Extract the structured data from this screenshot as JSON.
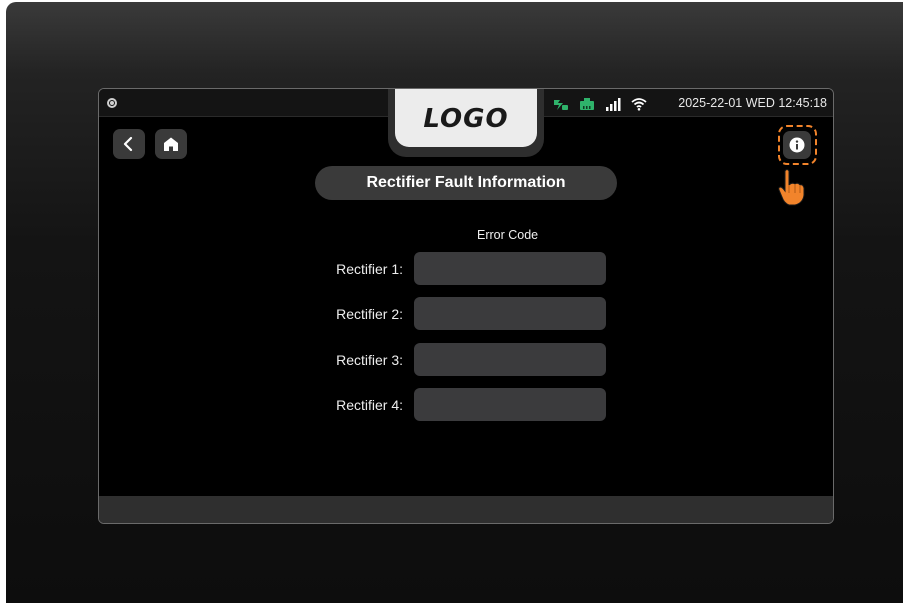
{
  "statusbar": {
    "logo_text": "LOGO",
    "datetime": "2025-22-01 WED 12:45:18",
    "icons": [
      "camera-icon",
      "charging-icon",
      "ethernet-icon",
      "signal-icon",
      "wifi-icon"
    ]
  },
  "nav": {
    "back_icon": "chevron-left-icon",
    "home_icon": "home-icon",
    "info_icon": "info-icon",
    "pointer_icon": "hand-pointer-icon"
  },
  "page": {
    "title": "Rectifier Fault Information",
    "column_header": "Error Code",
    "rows": [
      {
        "label": "Rectifier 1:",
        "value": ""
      },
      {
        "label": "Rectifier 2:",
        "value": ""
      },
      {
        "label": "Rectifier 3:",
        "value": ""
      },
      {
        "label": "Rectifier 4:",
        "value": ""
      }
    ]
  },
  "colors": {
    "accent_highlight": "#f2842b",
    "status_green": "#2fb36b",
    "panel": "#3a3a3a",
    "background": "#000000"
  }
}
